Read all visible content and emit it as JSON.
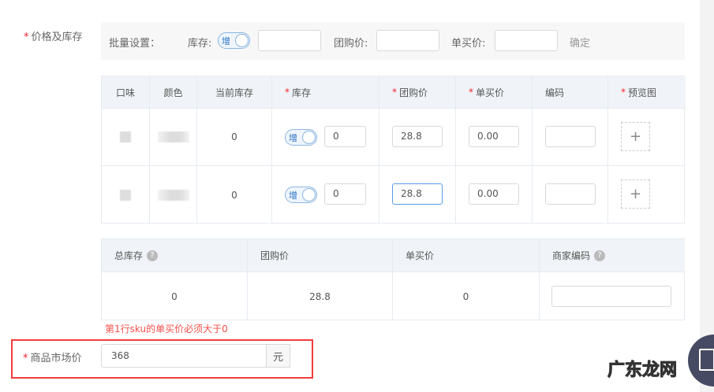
{
  "section_label": "价格及库存",
  "batch": {
    "title": "批量设置：",
    "stock_label": "库存:",
    "toggle_text": "增",
    "group_price_label": "团购价:",
    "single_price_label": "单买价:",
    "confirm": "确定"
  },
  "sku_table": {
    "headers": [
      "口味",
      "颜色",
      "当前库存",
      "库存",
      "团购价",
      "单买价",
      "编码",
      "预览图"
    ],
    "required": [
      false,
      false,
      false,
      true,
      true,
      true,
      false,
      true
    ],
    "rows": [
      {
        "current_stock": "0",
        "toggle": "增",
        "stock": "0",
        "group_price": "28.8",
        "single_price": "0.00",
        "code": ""
      },
      {
        "current_stock": "0",
        "toggle": "增",
        "stock": "0",
        "group_price": "28.8",
        "single_price": "0.00",
        "code": ""
      }
    ],
    "add_icon": "+"
  },
  "summary": {
    "headers": [
      "总库存",
      "团购价",
      "单买价",
      "商家编码"
    ],
    "values": [
      "0",
      "28.8",
      "0",
      ""
    ]
  },
  "error": "第1行sku的单买价必须大于0",
  "market_price": {
    "label": "商品市场价",
    "value": "368",
    "unit": "元"
  },
  "watermark": "广东龙网"
}
